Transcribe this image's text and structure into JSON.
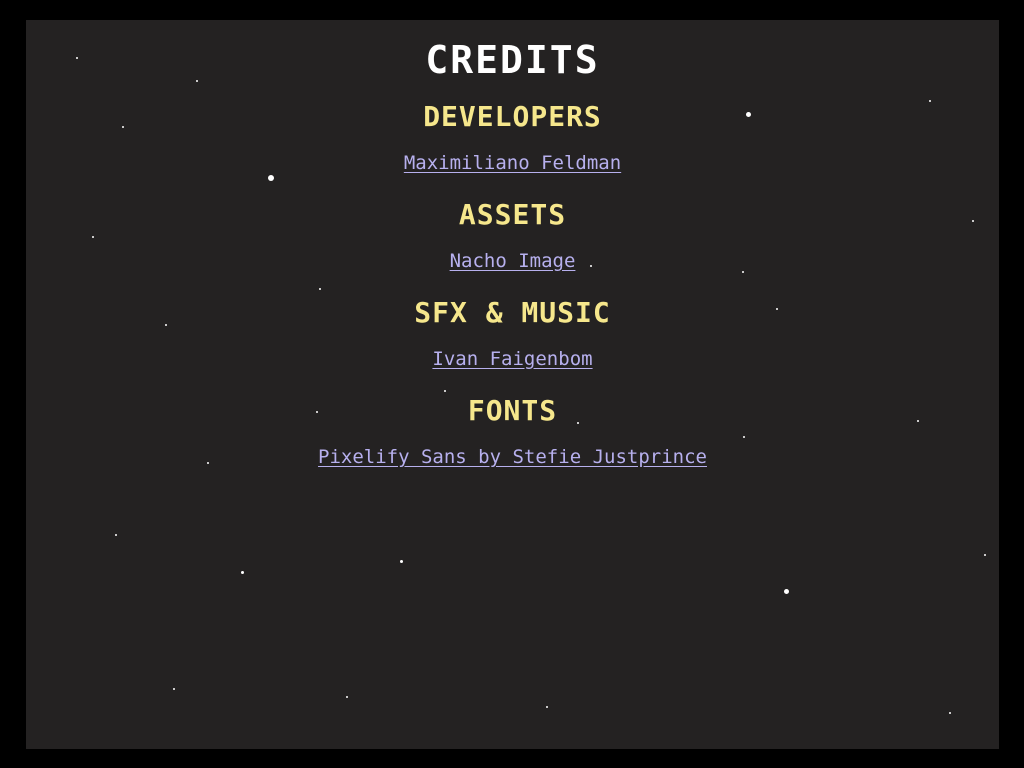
{
  "screen": {
    "title": "CREDITS",
    "background_color": "#242222",
    "frame_color": "#000000",
    "heading_color": "#f6e78c",
    "link_color": "#b7b0ee"
  },
  "sections": [
    {
      "heading": "DEVELOPERS",
      "credit": "Maximiliano Feldman"
    },
    {
      "heading": "ASSETS",
      "credit": "Nacho Image"
    },
    {
      "heading": "SFX & MUSIC",
      "credit": "Ivan Faigenbom"
    },
    {
      "heading": "FONTS",
      "credit": "Pixelify Sans by Stefie Justprince"
    }
  ]
}
